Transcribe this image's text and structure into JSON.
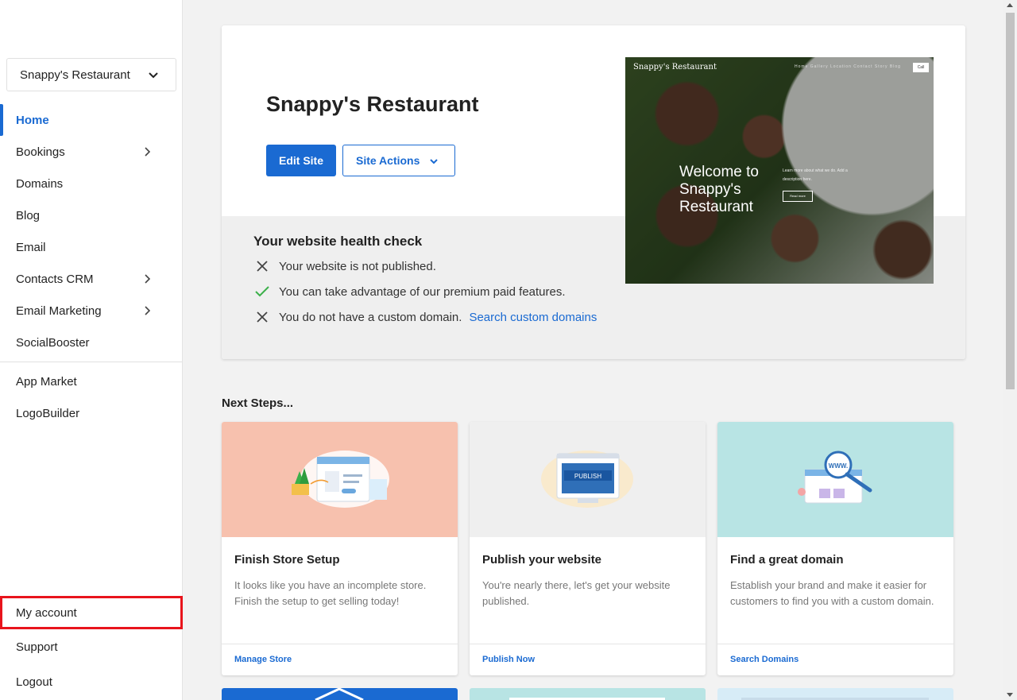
{
  "site_selector": {
    "label": "Snappy's Restaurant"
  },
  "sidebar": {
    "items": [
      {
        "label": "Home",
        "active": true,
        "has_submenu": false
      },
      {
        "label": "Bookings",
        "active": false,
        "has_submenu": true
      },
      {
        "label": "Domains",
        "active": false,
        "has_submenu": false
      },
      {
        "label": "Blog",
        "active": false,
        "has_submenu": false
      },
      {
        "label": "Email",
        "active": false,
        "has_submenu": false
      },
      {
        "label": "Contacts CRM",
        "active": false,
        "has_submenu": true
      },
      {
        "label": "Email Marketing",
        "active": false,
        "has_submenu": true
      },
      {
        "label": "SocialBooster",
        "active": false,
        "has_submenu": false
      }
    ],
    "secondary": [
      {
        "label": "App Market"
      },
      {
        "label": "LogoBuilder"
      }
    ],
    "bottom": [
      {
        "label": "My account"
      },
      {
        "label": "Support"
      },
      {
        "label": "Logout"
      }
    ]
  },
  "hero": {
    "title": "Snappy's Restaurant",
    "edit_label": "Edit Site",
    "actions_label": "Site Actions",
    "health_title": "Your website health check",
    "health": [
      {
        "status": "fail",
        "text": "Your website is not published.",
        "link": ""
      },
      {
        "status": "pass",
        "text": "You can take advantage of our premium paid features.",
        "link": ""
      },
      {
        "status": "fail",
        "text": "You do not have a custom domain.",
        "link": "Search custom domains"
      }
    ],
    "preview": {
      "brand": "Snappy's Restaurant",
      "nav": "Home  Gallery  Location  Contact  Story  Blog",
      "call": "Call",
      "welcome": "Welcome to Snappy's Restaurant",
      "sub": "Learn more about what we do. Add a description here.",
      "button": "Read more"
    }
  },
  "next_steps": {
    "title": "Next Steps...",
    "cards": [
      {
        "title": "Finish Store Setup",
        "desc": "It looks like you have an incomplete store. Finish the setup to get selling today!",
        "link": "Manage Store",
        "bg": "#f7c1ae"
      },
      {
        "title": "Publish your website",
        "desc": "You're nearly there, let's get your website published.",
        "link": "Publish Now",
        "bg": "#efefef",
        "badge": "PUBLISH"
      },
      {
        "title": "Find a great domain",
        "desc": "Establish your brand and make it easier for customers to find you with a custom domain.",
        "link": "Search Domains",
        "bg": "#b8e4e4",
        "badge": "WWW."
      }
    ]
  },
  "colors": {
    "accent": "#1a6ad2",
    "highlight_box": "#e8141c",
    "pass": "#3bb04a",
    "fail": "#444444"
  }
}
